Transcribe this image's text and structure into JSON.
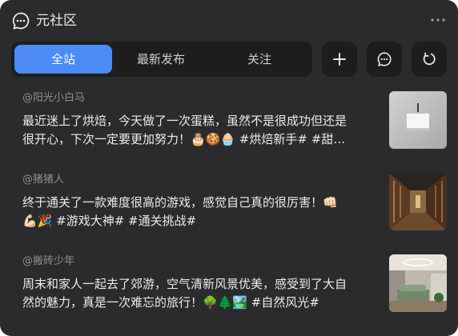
{
  "header": {
    "title": "元社区",
    "app_icon": "chat-bubble-icon",
    "more_icon": "more-horizontal-icon"
  },
  "tabs": [
    {
      "label": "全站",
      "active": true
    },
    {
      "label": "最新发布",
      "active": false
    },
    {
      "label": "关注",
      "active": false
    }
  ],
  "actions": {
    "add_icon": "plus-icon",
    "message_icon": "chat-bubble-icon",
    "refresh_icon": "refresh-icon"
  },
  "posts": [
    {
      "author": "@阳光小白马",
      "text": "最近迷上了烘焙，今天做了一次蛋糕，虽然不是很成功但还是\n很开心，下次一定要更加努力！🎂🍪🧁 #烘焙新手# #甜…",
      "thumbnail": "white-box-on-grey-photo"
    },
    {
      "author": "@猪猪人",
      "text": "终于通关了一款难度很高的游戏，感觉自己真的很厉害！👊🏻\n💪🏻🎉 #游戏大神# #通关挑战#",
      "thumbnail": "corridor-photo"
    },
    {
      "author": "@搬砖少年",
      "text": "周末和家人一起去了郊游，空气清新风景优美，感受到了大自\n然的魅力，真是一次难忘的旅行！🌳🌲🏞️ #自然风光#",
      "thumbnail": "interior-room-photo"
    }
  ],
  "colors": {
    "background": "#2b2b2d",
    "accent": "#4c8af5",
    "panel": "#1d1d1f"
  }
}
